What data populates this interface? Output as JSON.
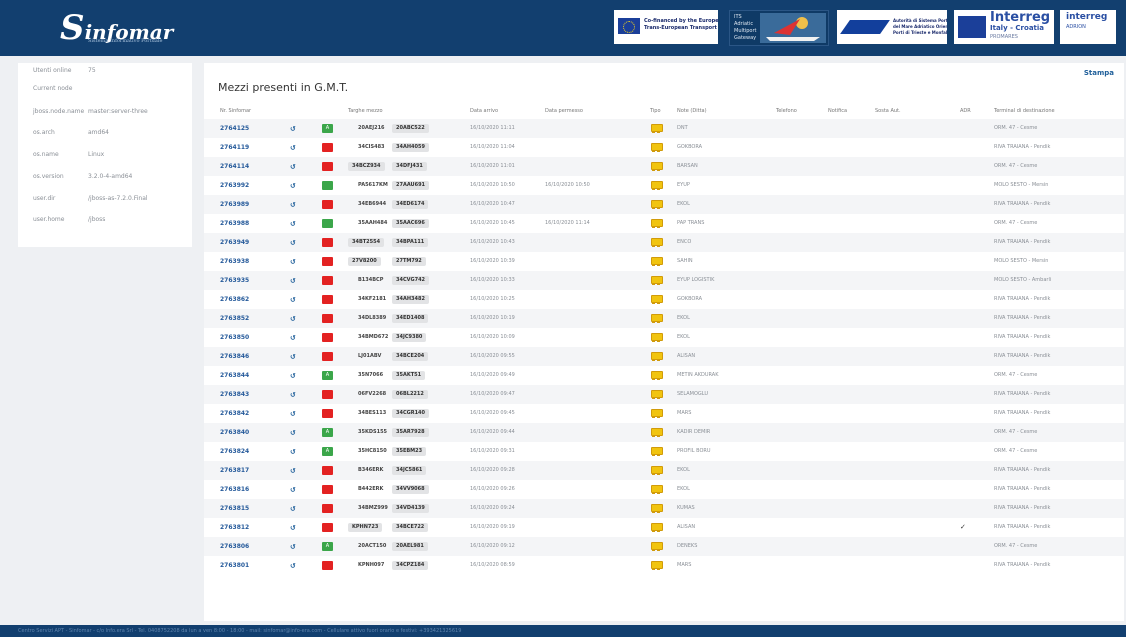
{
  "header": {
    "logo_s": "S",
    "logo_rest": "infomar",
    "logo_sub": "Sistema Informativo Portuale",
    "eu_label": "Co-financed by the European Union\nTrans-European Transport Network (TEN-T)",
    "its_label": "ITS\nAdriatic\nMultiport\nGateway",
    "adsp_label": "Autorità di Sistema Portuale\ndel Mare Adriatico Orientale\nPorti di Trieste e Monfalcone",
    "interreg_title": "Interreg",
    "interreg_sub": "Italy - Croatia",
    "interreg_sub2": "PROMARES",
    "interreg2_title": "interreg",
    "interreg2_sub": "ADRION"
  },
  "sidebar": {
    "rows": [
      {
        "key": "Utenti online",
        "value": "75"
      },
      {
        "key": "Current node",
        "value": ""
      },
      {
        "key": "jboss.node.name",
        "value": "master:server-three"
      },
      {
        "key": "os.arch",
        "value": "amd64"
      },
      {
        "key": "os.name",
        "value": "Linux"
      },
      {
        "key": "os.version",
        "value": "3.2.0-4-amd64"
      },
      {
        "key": "user.dir",
        "value": "/jboss-as-7.2.0.Final"
      },
      {
        "key": "user.home",
        "value": "/jboss"
      }
    ]
  },
  "main": {
    "title": "Mezzi presenti in G.M.T.",
    "print_label": "Stampa",
    "columns": {
      "nr": "Nr. Sinfomar",
      "targhe": "Targhe mezzo",
      "arrivo": "Data arrivo",
      "permesso": "Data permesso",
      "tipo": "Tipo",
      "note": "Note (Ditta)",
      "telefono": "Telefono",
      "notifica": "Notifica",
      "sosta": "Sosta Aut.",
      "adr": "ADR",
      "terminal": "Terminal di destinazione"
    },
    "rows": [
      {
        "nr": "2764125",
        "status": "A",
        "plate1": "20AEJ216",
        "plate2": "20ABC522",
        "arrivo": "16/10/2020 11:11",
        "permesso": "",
        "note": "DNT",
        "adr": "",
        "terminal": "ORM. 47 - Cesme"
      },
      {
        "nr": "2764119",
        "status": "R",
        "plate1": "34CIS483",
        "plate2": "34AH4059",
        "arrivo": "16/10/2020 11:04",
        "permesso": "",
        "note": "GOKBORA",
        "adr": "",
        "terminal": "RIVA TRAIANA - Pendik"
      },
      {
        "nr": "2764114",
        "status": "R",
        "plate1": "34BCZ934",
        "plate2": "34DFJ431",
        "arrivo": "16/10/2020 11:01",
        "permesso": "",
        "note": "BARSAN",
        "adr": "",
        "terminal": "ORM. 47 - Cesme",
        "pill1": true
      },
      {
        "nr": "2763992",
        "status": "G",
        "plate1": "PA5617KM",
        "plate2": "27AAU691",
        "arrivo": "16/10/2020 10:50",
        "permesso": "16/10/2020 10:50",
        "note": "EYUP",
        "adr": "",
        "terminal": "MOLO SESTO - Mersin"
      },
      {
        "nr": "2763989",
        "status": "R",
        "plate1": "34EB6944",
        "plate2": "34ED6174",
        "arrivo": "16/10/2020 10:47",
        "permesso": "",
        "note": "EKOL",
        "adr": "",
        "terminal": "RIVA TRAIANA - Pendik"
      },
      {
        "nr": "2763988",
        "status": "G",
        "plate1": "35AAH484",
        "plate2": "35AAC696",
        "arrivo": "16/10/2020 10:45",
        "permesso": "16/10/2020 11:14",
        "note": "PAP TRANS",
        "adr": "",
        "terminal": "ORM. 47 - Cesme"
      },
      {
        "nr": "2763949",
        "status": "R",
        "plate1": "34BT2554",
        "plate2": "34BPA111",
        "arrivo": "16/10/2020 10:43",
        "permesso": "",
        "note": "ENCO",
        "adr": "",
        "terminal": "RIVA TRAIANA - Pendik",
        "pill1": true
      },
      {
        "nr": "2763938",
        "status": "R",
        "plate1": "27V8200",
        "plate2": "27TM792",
        "arrivo": "16/10/2020 10:39",
        "permesso": "",
        "note": "SAHIN",
        "adr": "",
        "terminal": "MOLO SESTO - Mersin",
        "pill1": true
      },
      {
        "nr": "2763935",
        "status": "R",
        "plate1": "B134BCP",
        "plate2": "34CVG742",
        "arrivo": "16/10/2020 10:33",
        "permesso": "",
        "note": "EYUP LOGISTIK",
        "adr": "",
        "terminal": "MOLO SESTO - Ambarli"
      },
      {
        "nr": "2763862",
        "status": "R",
        "plate1": "34KF2181",
        "plate2": "34AH3482",
        "arrivo": "16/10/2020 10:25",
        "permesso": "",
        "note": "GOKBORA",
        "adr": "",
        "terminal": "RIVA TRAIANA - Pendik"
      },
      {
        "nr": "2763852",
        "status": "R",
        "plate1": "34DL8389",
        "plate2": "34ED1408",
        "arrivo": "16/10/2020 10:19",
        "permesso": "",
        "note": "EKOL",
        "adr": "",
        "terminal": "RIVA TRAIANA - Pendik"
      },
      {
        "nr": "2763850",
        "status": "R",
        "plate1": "34BMD672",
        "plate2": "34JC9380",
        "arrivo": "16/10/2020 10:09",
        "permesso": "",
        "note": "EKOL",
        "adr": "",
        "terminal": "RIVA TRAIANA - Pendik"
      },
      {
        "nr": "2763846",
        "status": "R",
        "plate1": "LJ01ABV",
        "plate2": "34BCE204",
        "arrivo": "16/10/2020 09:55",
        "permesso": "",
        "note": "ALISAN",
        "adr": "",
        "terminal": "RIVA TRAIANA - Pendik"
      },
      {
        "nr": "2763844",
        "status": "A",
        "plate1": "35N7066",
        "plate2": "35AKT51",
        "arrivo": "16/10/2020 09:49",
        "permesso": "",
        "note": "METIN AKDURAK",
        "adr": "",
        "terminal": "ORM. 47 - Cesme"
      },
      {
        "nr": "2763843",
        "status": "R",
        "plate1": "06FV2268",
        "plate2": "06BL2212",
        "arrivo": "16/10/2020 09:47",
        "permesso": "",
        "note": "SELAMOGLU",
        "adr": "",
        "terminal": "RIVA TRAIANA - Pendik"
      },
      {
        "nr": "2763842",
        "status": "R",
        "plate1": "34BES113",
        "plate2": "34CGR140",
        "arrivo": "16/10/2020 09:45",
        "permesso": "",
        "note": "MARS",
        "adr": "",
        "terminal": "RIVA TRAIANA - Pendik"
      },
      {
        "nr": "2763840",
        "status": "A",
        "plate1": "35KDS155",
        "plate2": "35AR7928",
        "arrivo": "16/10/2020 09:44",
        "permesso": "",
        "note": "KADIR DEMIR",
        "adr": "",
        "terminal": "ORM. 47 - Cesme"
      },
      {
        "nr": "2763824",
        "status": "A",
        "plate1": "35HC8150",
        "plate2": "35EBM23",
        "arrivo": "16/10/2020 09:31",
        "permesso": "",
        "note": "PROFIL BORU",
        "adr": "",
        "terminal": "ORM. 47 - Cesme"
      },
      {
        "nr": "2763817",
        "status": "R",
        "plate1": "B346ERK",
        "plate2": "34JC5861",
        "arrivo": "16/10/2020 09:28",
        "permesso": "",
        "note": "EKOL",
        "adr": "",
        "terminal": "RIVA TRAIANA - Pendik"
      },
      {
        "nr": "2763816",
        "status": "R",
        "plate1": "B442ERK",
        "plate2": "34VV9068",
        "arrivo": "16/10/2020 09:26",
        "permesso": "",
        "note": "EKOL",
        "adr": "",
        "terminal": "RIVA TRAIANA - Pendik"
      },
      {
        "nr": "2763815",
        "status": "R",
        "plate1": "34BMZ999",
        "plate2": "34VD4139",
        "arrivo": "16/10/2020 09:24",
        "permesso": "",
        "note": "KUMAS",
        "adr": "",
        "terminal": "RIVA TRAIANA - Pendik"
      },
      {
        "nr": "2763812",
        "status": "R",
        "plate1": "KPHN723",
        "plate2": "34BCE722",
        "arrivo": "16/10/2020 09:19",
        "permesso": "",
        "note": "ALISAN",
        "adr": "✓",
        "terminal": "RIVA TRAIANA - Pendik",
        "pill1": true
      },
      {
        "nr": "2763806",
        "status": "A",
        "plate1": "20ACT150",
        "plate2": "20AEL981",
        "arrivo": "16/10/2020 09:12",
        "permesso": "",
        "note": "DENEKS",
        "adr": "",
        "terminal": "ORM. 47 - Cesme"
      },
      {
        "nr": "2763801",
        "status": "R",
        "plate1": "KPNH097",
        "plate2": "34CPZ184",
        "arrivo": "16/10/2020 08:59",
        "permesso": "",
        "note": "MARS",
        "adr": "",
        "terminal": "RIVA TRAIANA - Pendik"
      }
    ]
  },
  "footer": {
    "text": "Centro Servizi APT - Sinfomar - c/o Info.era Srl - Tel. 0408752208 da lun a ven 8:00 - 18:00 - mail: sinfomar@info-era.com - Cellulare attivo fuori orario e festivi: +393421325619"
  },
  "colors": {
    "header_bg": "#123f6f",
    "link": "#24599a",
    "status_green": "#3ba64a",
    "status_red": "#e32222",
    "truck_yellow": "#f1c40f"
  },
  "icons": {
    "history": "history-icon",
    "truck": "truck-icon",
    "check": "check-icon"
  }
}
